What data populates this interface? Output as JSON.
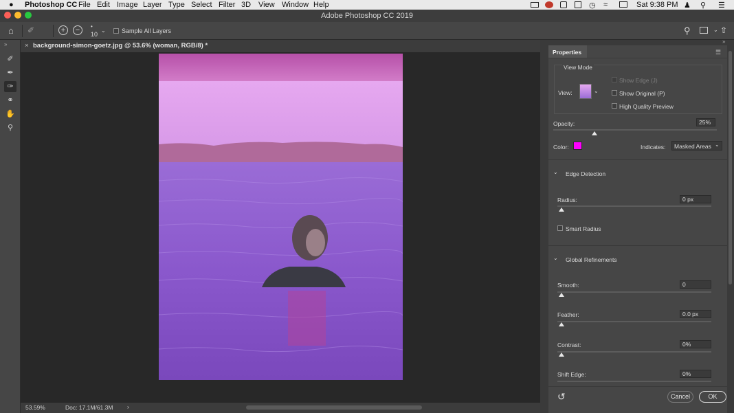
{
  "menubar": {
    "apple": "",
    "app_name": "Photoshop CC",
    "items": [
      "File",
      "Edit",
      "Image",
      "Layer",
      "Type",
      "Select",
      "Filter",
      "3D",
      "View",
      "Window",
      "Help"
    ],
    "clock": "Sat 9:38 PM"
  },
  "window": {
    "title": "Adobe Photoshop CC 2019"
  },
  "options": {
    "brush_size": "10",
    "sample_all_layers": "Sample All Layers"
  },
  "document": {
    "tab_label": "background-simon-goetz.jpg @ 53.6% (woman, RGB/8) *",
    "tab_close": "×"
  },
  "status": {
    "zoom": "53.59%",
    "doc": "Doc: 17.1M/61.3M",
    "arrow": "›"
  },
  "properties": {
    "panel_title": "Properties",
    "view_mode": {
      "heading": "View Mode",
      "view_label": "View:",
      "show_edge": "Show Edge (J)",
      "show_original": "Show Original (P)",
      "high_quality": "High Quality Preview"
    },
    "opacity": {
      "label": "Opacity:",
      "value": "25%",
      "level": 0.25
    },
    "color_label": "Color:",
    "overlay_color": "#ff00ff",
    "indicates": {
      "label": "Indicates:",
      "value": "Masked Areas"
    },
    "edge_detection": {
      "heading": "Edge Detection",
      "radius_label": "Radius:",
      "radius_value": "0 px",
      "smart_radius": "Smart Radius"
    },
    "global_refinements": {
      "heading": "Global Refinements",
      "smooth_label": "Smooth:",
      "smooth_value": "0",
      "feather_label": "Feather:",
      "feather_value": "0.0 px",
      "contrast_label": "Contrast:",
      "contrast_value": "0%",
      "shift_label": "Shift Edge:",
      "shift_value": "0%"
    },
    "cancel": "Cancel",
    "ok": "OK"
  }
}
